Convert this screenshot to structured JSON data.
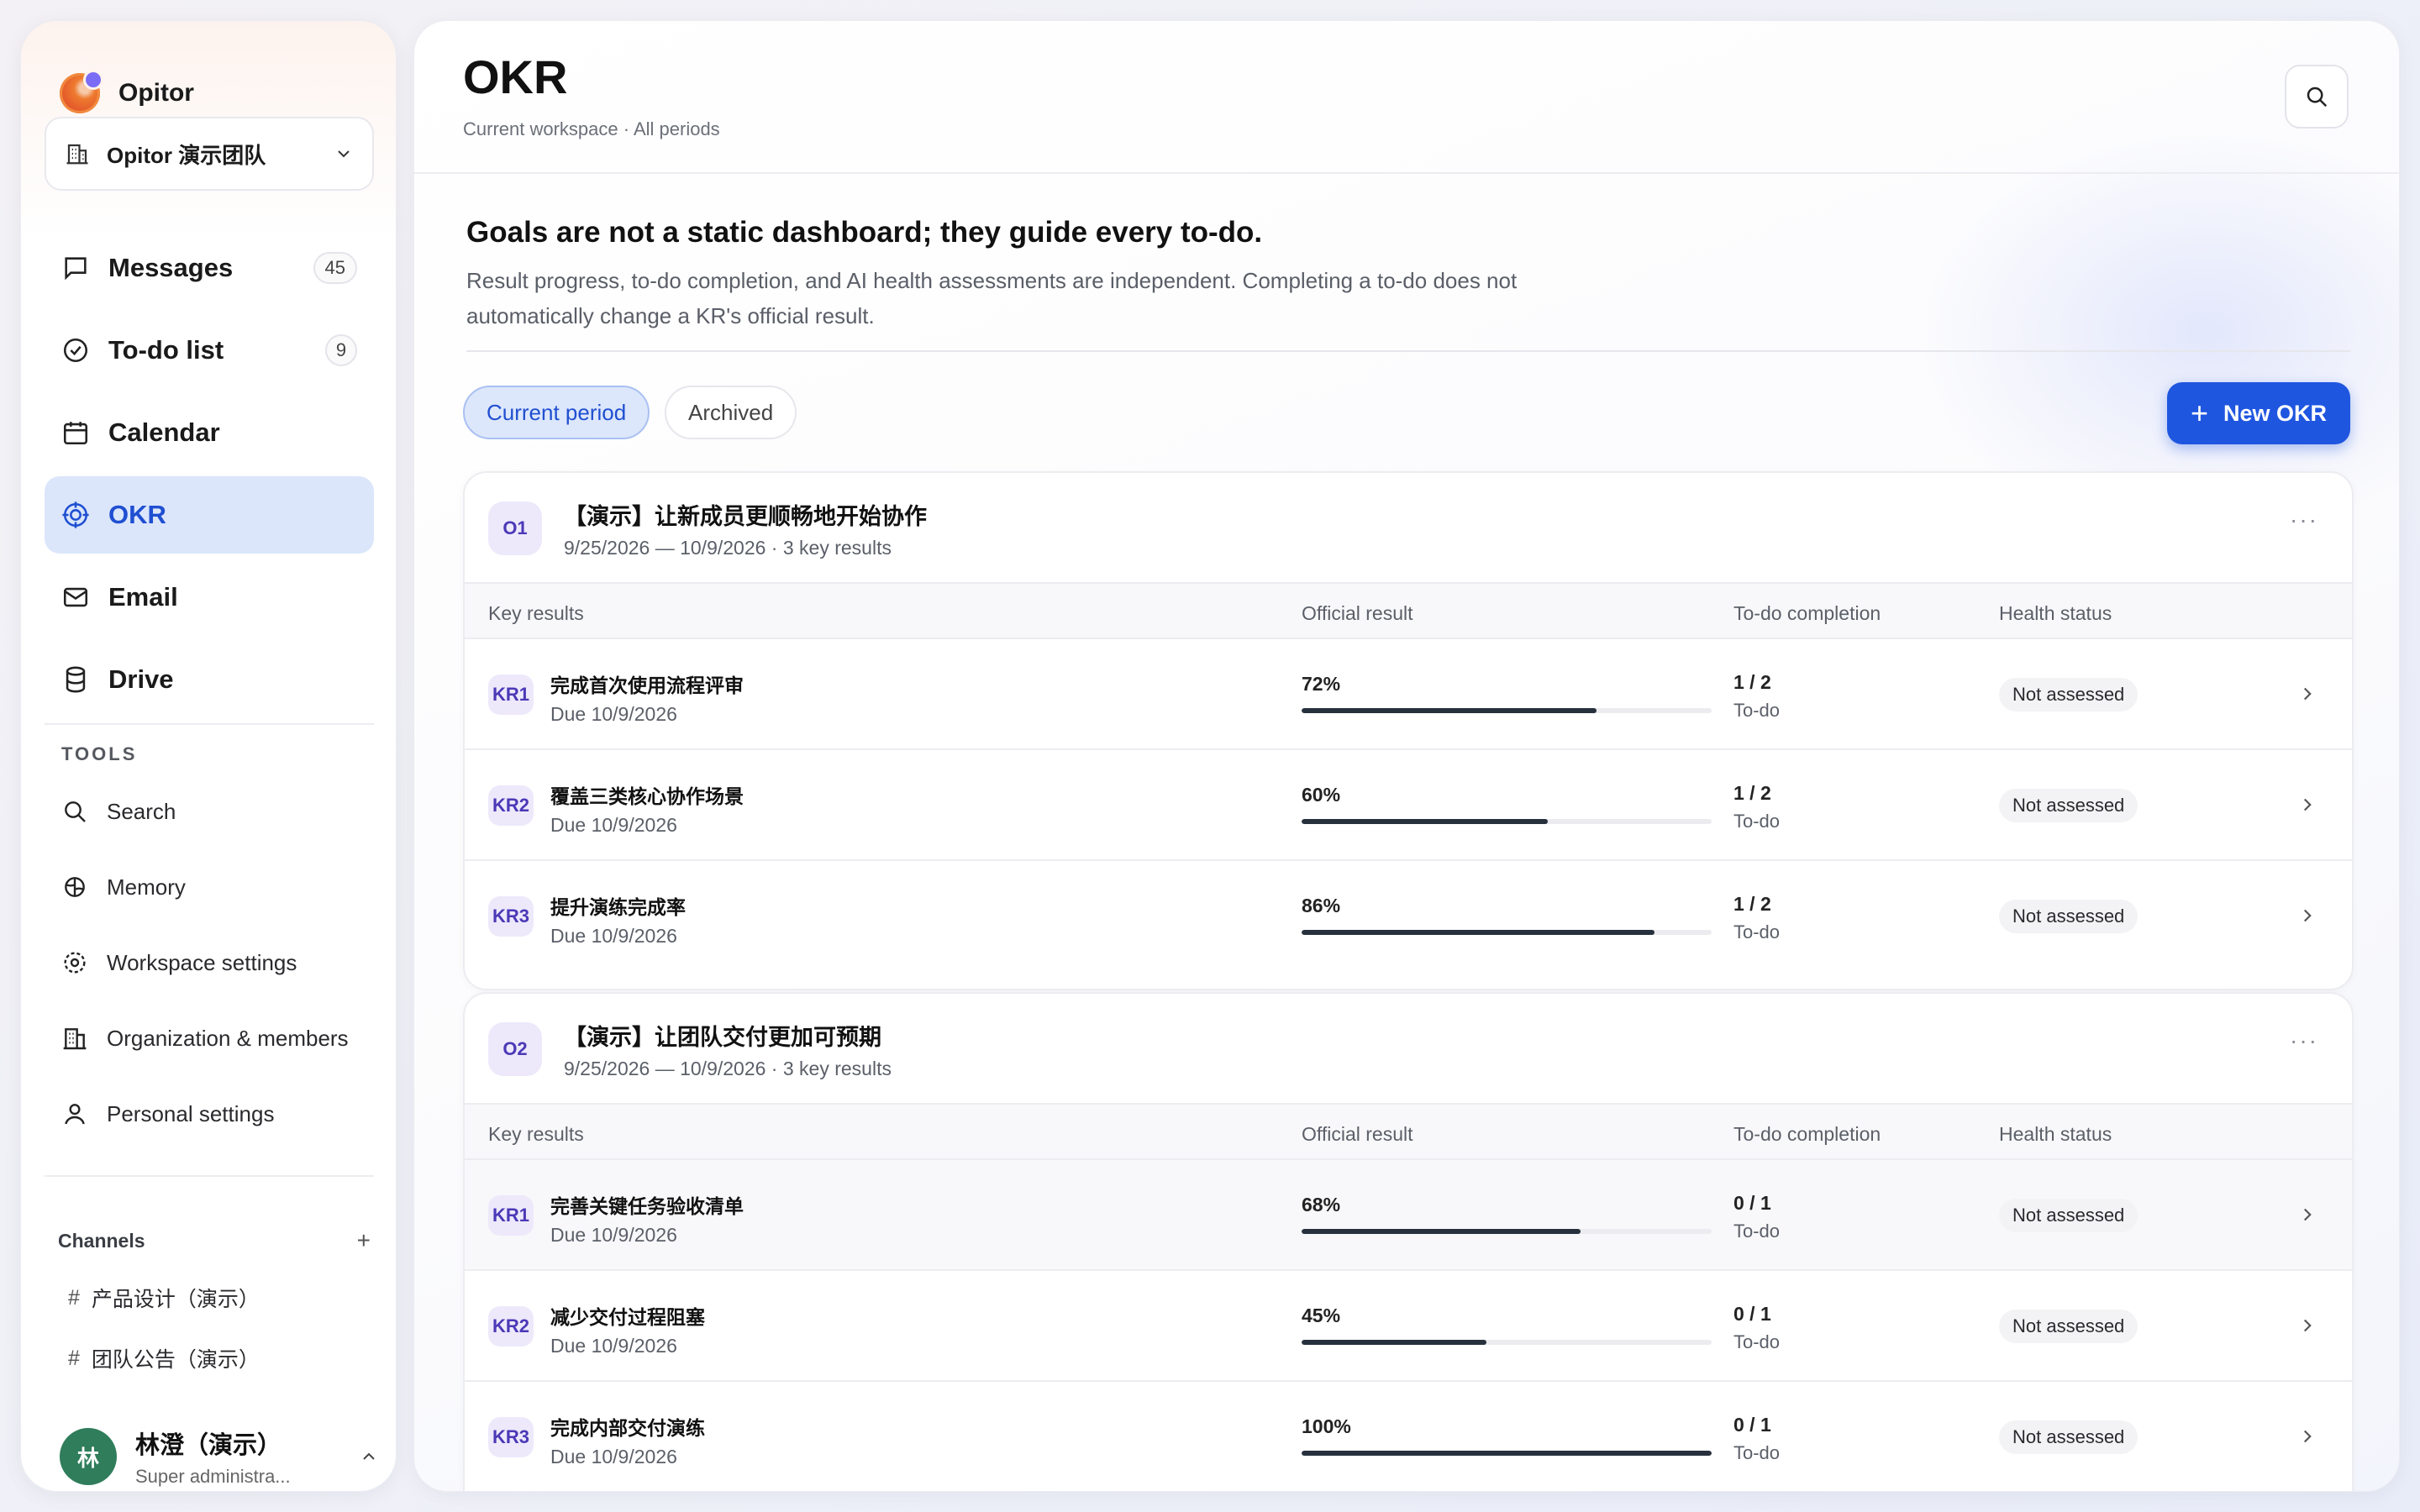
{
  "app": {
    "name": "Opitor"
  },
  "workspace": {
    "name": "Opitor 演示团队"
  },
  "nav": [
    {
      "label": "Messages",
      "icon": "message-icon",
      "badge": "45"
    },
    {
      "label": "To-do list",
      "icon": "check-circle-icon",
      "badge": "9"
    },
    {
      "label": "Calendar",
      "icon": "calendar-icon",
      "badge": ""
    },
    {
      "label": "OKR",
      "icon": "target-icon",
      "badge": "",
      "active": true
    },
    {
      "label": "Email",
      "icon": "mail-icon",
      "badge": ""
    },
    {
      "label": "Drive",
      "icon": "database-icon",
      "badge": ""
    }
  ],
  "tools": {
    "heading": "TOOLS",
    "items": [
      {
        "label": "Search",
        "icon": "search-icon"
      },
      {
        "label": "Memory",
        "icon": "brain-icon"
      },
      {
        "label": "Workspace settings",
        "icon": "gear-icon"
      },
      {
        "label": "Organization & members",
        "icon": "building-icon"
      },
      {
        "label": "Personal settings",
        "icon": "user-icon"
      }
    ]
  },
  "channels": {
    "heading": "Channels",
    "add_label": "+",
    "items": [
      "产品设计（演示）",
      "团队公告（演示）"
    ]
  },
  "user": {
    "initial": "林",
    "name": "林澄（演示）",
    "role": "Super administra..."
  },
  "header": {
    "title": "OKR",
    "subtitle": "Current workspace · All periods"
  },
  "intro": {
    "title": "Goals are not a static dashboard; they guide every to-do.",
    "description": "Result progress, to-do completion, and AI health assessments are independent. Completing a to-do does not automatically change a KR's official result."
  },
  "tabs": {
    "current": "Current period",
    "archived": "Archived"
  },
  "new_button": "New OKR",
  "columns": {
    "key_results": "Key results",
    "official_result": "Official result",
    "todo_completion": "To-do completion",
    "health_status": "Health status"
  },
  "objectives": [
    {
      "badge": "O1",
      "title": "【演示】让新成员更顺畅地开始协作",
      "meta": "9/25/2026 — 10/9/2026 · 3 key results",
      "key_results": [
        {
          "badge": "KR1",
          "title": "完成首次使用流程评审",
          "due": "Due 10/9/2026",
          "result": "72%",
          "progress": 0.72,
          "todo": "1 / 2",
          "todo_label": "To-do",
          "health": "Not assessed"
        },
        {
          "badge": "KR2",
          "title": "覆盖三类核心协作场景",
          "due": "Due 10/9/2026",
          "result": "60%",
          "progress": 0.6,
          "todo": "1 / 2",
          "todo_label": "To-do",
          "health": "Not assessed"
        },
        {
          "badge": "KR3",
          "title": "提升演练完成率",
          "due": "Due 10/9/2026",
          "result": "86%",
          "progress": 0.86,
          "todo": "1 / 2",
          "todo_label": "To-do",
          "health": "Not assessed"
        }
      ]
    },
    {
      "badge": "O2",
      "title": "【演示】让团队交付更加可预期",
      "meta": "9/25/2026 — 10/9/2026 · 3 key results",
      "key_results": [
        {
          "badge": "KR1",
          "title": "完善关键任务验收清单",
          "due": "Due 10/9/2026",
          "result": "68%",
          "progress": 0.68,
          "todo": "0 / 1",
          "todo_label": "To-do",
          "health": "Not assessed"
        },
        {
          "badge": "KR2",
          "title": "减少交付过程阻塞",
          "due": "Due 10/9/2026",
          "result": "45%",
          "progress": 0.45,
          "todo": "0 / 1",
          "todo_label": "To-do",
          "health": "Not assessed"
        },
        {
          "badge": "KR3",
          "title": "完成内部交付演练",
          "due": "Due 10/9/2026",
          "result": "100%",
          "progress": 1.0,
          "todo": "0 / 1",
          "todo_label": "To-do",
          "health": "Not assessed"
        }
      ]
    }
  ],
  "colors": {
    "accent": "#1f56e0",
    "active_nav_bg": "#dbe6fb",
    "badge_bg": "#ede9fb",
    "badge_text": "#4b39b7",
    "avatar": "#2f7d5b"
  }
}
